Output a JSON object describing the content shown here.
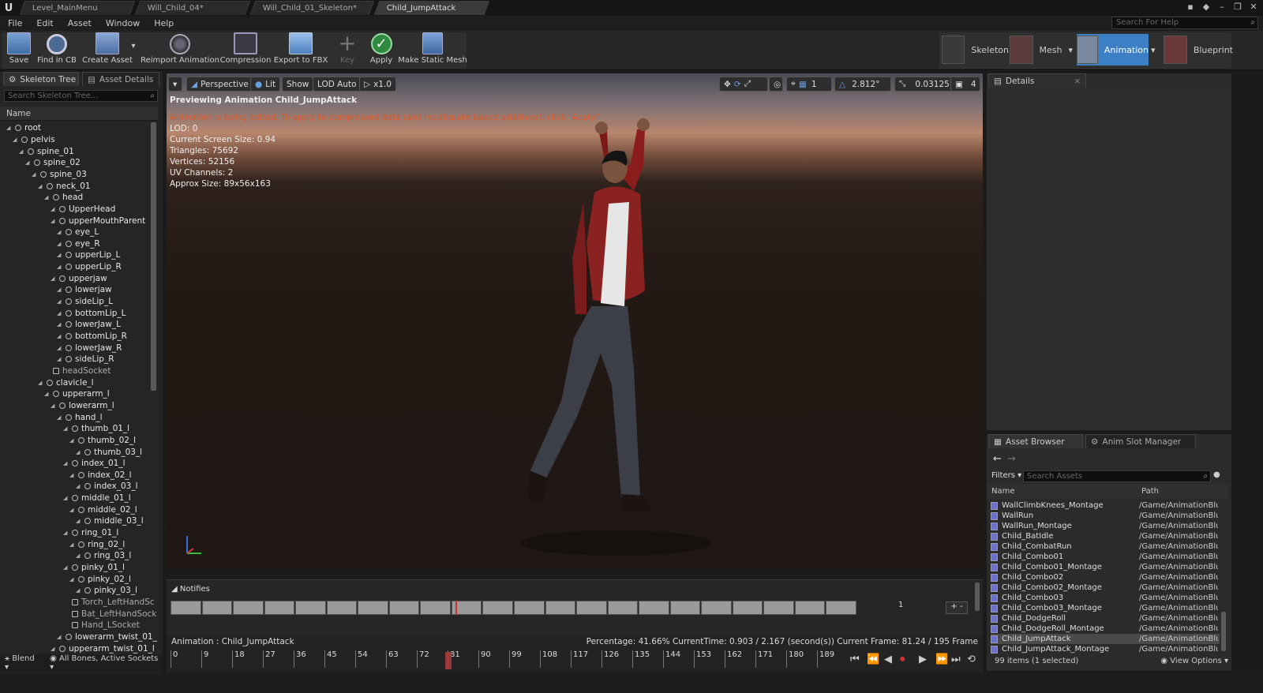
{
  "tabs": [
    {
      "label": "Level_MainMenu",
      "active": false
    },
    {
      "label": "Will_Child_04*",
      "active": false
    },
    {
      "label": "Will_Child_01_Skeleton*",
      "active": false
    },
    {
      "label": "Child_JumpAttack",
      "active": true
    }
  ],
  "menu": [
    "File",
    "Edit",
    "Asset",
    "Window",
    "Help"
  ],
  "help_search_placeholder": "Search For Help",
  "toolbar": {
    "save": "Save",
    "find_in_cb": "Find in CB",
    "create_asset": "Create Asset",
    "reimport": "Reimport Animation",
    "compression": "Compression",
    "export_fbx": "Export to FBX",
    "key": "Key",
    "apply": "Apply",
    "make_static_mesh": "Make Static Mesh"
  },
  "modes": {
    "skeleton": "Skeleton",
    "mesh": "Mesh",
    "animation": "Animation",
    "blueprint": "Blueprint"
  },
  "left_panel": {
    "tab_skeleton_tree": "Skeleton Tree",
    "tab_asset_details": "Asset Details",
    "search_placeholder": "Search Skeleton Tree...",
    "column_name": "Name",
    "bones": [
      {
        "name": "root",
        "depth": 0
      },
      {
        "name": "pelvis",
        "depth": 1
      },
      {
        "name": "spine_01",
        "depth": 2
      },
      {
        "name": "spine_02",
        "depth": 3
      },
      {
        "name": "spine_03",
        "depth": 4
      },
      {
        "name": "neck_01",
        "depth": 5
      },
      {
        "name": "head",
        "depth": 6
      },
      {
        "name": "UpperHead",
        "depth": 7
      },
      {
        "name": "upperMouthParent",
        "depth": 7
      },
      {
        "name": "eye_L",
        "depth": 8
      },
      {
        "name": "eye_R",
        "depth": 8
      },
      {
        "name": "upperLip_L",
        "depth": 8
      },
      {
        "name": "upperLip_R",
        "depth": 8
      },
      {
        "name": "upperjaw",
        "depth": 7
      },
      {
        "name": "lowerjaw",
        "depth": 8
      },
      {
        "name": "sideLip_L",
        "depth": 8
      },
      {
        "name": "bottomLip_L",
        "depth": 8
      },
      {
        "name": "lowerJaw_L",
        "depth": 8
      },
      {
        "name": "bottomLip_R",
        "depth": 8
      },
      {
        "name": "lowerJaw_R",
        "depth": 8
      },
      {
        "name": "sideLip_R",
        "depth": 8
      },
      {
        "name": "headSocket",
        "depth": 6,
        "socket": true
      },
      {
        "name": "clavicle_l",
        "depth": 5
      },
      {
        "name": "upperarm_l",
        "depth": 6
      },
      {
        "name": "lowerarm_l",
        "depth": 7
      },
      {
        "name": "hand_l",
        "depth": 8
      },
      {
        "name": "thumb_01_l",
        "depth": 9
      },
      {
        "name": "thumb_02_l",
        "depth": 10
      },
      {
        "name": "thumb_03_l",
        "depth": 11
      },
      {
        "name": "index_01_l",
        "depth": 9
      },
      {
        "name": "index_02_l",
        "depth": 10
      },
      {
        "name": "index_03_l",
        "depth": 11
      },
      {
        "name": "middle_01_l",
        "depth": 9
      },
      {
        "name": "middle_02_l",
        "depth": 10
      },
      {
        "name": "middle_03_l",
        "depth": 11
      },
      {
        "name": "ring_01_l",
        "depth": 9
      },
      {
        "name": "ring_02_l",
        "depth": 10
      },
      {
        "name": "ring_03_l",
        "depth": 11
      },
      {
        "name": "pinky_01_l",
        "depth": 9
      },
      {
        "name": "pinky_02_l",
        "depth": 10
      },
      {
        "name": "pinky_03_l",
        "depth": 11
      },
      {
        "name": "Torch_LeftHandSc",
        "depth": 9,
        "socket": true
      },
      {
        "name": "Bat_LeftHandSock",
        "depth": 9,
        "socket": true
      },
      {
        "name": "Hand_LSocket",
        "depth": 9,
        "socket": true
      },
      {
        "name": "lowerarm_twist_01_",
        "depth": 8
      },
      {
        "name": "upperarm_twist_01_l",
        "depth": 7
      }
    ],
    "blend_label": "Blend",
    "bones_filter": "All Bones, Active Sockets"
  },
  "viewport": {
    "perspective": "Perspective",
    "lit": "Lit",
    "show": "Show",
    "lod": "LOD Auto",
    "speed": "x1.0",
    "grid_size": "1",
    "angle": "2.812°",
    "scale": "0.03125",
    "camera_speed": "4",
    "preview_title": "Previewing Animation Child_JumpAttack",
    "warning": "Animation is being edited. To apply to compressed data (and recalculate baked additives), click \"Apply\"",
    "stats": [
      "LOD: 0",
      "Current Screen Size: 0.94",
      "Triangles: 75692",
      "Vertices: 52156",
      "UV Channels: 2",
      "Approx Size: 89x56x163"
    ]
  },
  "notifies": {
    "header": "Notifies",
    "track_number": "1"
  },
  "timeline": {
    "animation_label": "Animation :  Child_JumpAttack",
    "status": "Percentage:  41.66% CurrentTime:  0.903 / 2.167 (second(s)) Current Frame:  81.24 / 195 Frame",
    "ticks": [
      "0",
      "9",
      "18",
      "27",
      "36",
      "45",
      "54",
      "63",
      "72",
      "81",
      "90",
      "99",
      "108",
      "117",
      "126",
      "135",
      "144",
      "153",
      "162",
      "171",
      "180",
      "189"
    ],
    "playhead_frame": 81
  },
  "details": {
    "tab": "Details"
  },
  "asset_browser": {
    "tab_asset_browser": "Asset Browser",
    "tab_anim_slot": "Anim Slot Manager",
    "filters": "Filters",
    "search_placeholder": "Search Assets",
    "col_name": "Name",
    "col_path": "Path",
    "items": [
      {
        "name": "WallClimbKnees_Montage",
        "path": "/Game/AnimationBlue"
      },
      {
        "name": "WallRun",
        "path": "/Game/AnimationBlue"
      },
      {
        "name": "WallRun_Montage",
        "path": "/Game/AnimationBlue"
      },
      {
        "name": "Child_BatIdle",
        "path": "/Game/AnimationBlue"
      },
      {
        "name": "Child_CombatRun",
        "path": "/Game/AnimationBlue"
      },
      {
        "name": "Child_Combo01",
        "path": "/Game/AnimationBlue"
      },
      {
        "name": "Child_Combo01_Montage",
        "path": "/Game/AnimationBlue"
      },
      {
        "name": "Child_Combo02",
        "path": "/Game/AnimationBlue"
      },
      {
        "name": "Child_Combo02_Montage",
        "path": "/Game/AnimationBlue"
      },
      {
        "name": "Child_Combo03",
        "path": "/Game/AnimationBlue"
      },
      {
        "name": "Child_Combo03_Montage",
        "path": "/Game/AnimationBlue"
      },
      {
        "name": "Child_DodgeRoll",
        "path": "/Game/AnimationBlue"
      },
      {
        "name": "Child_DodgeRoll_Montage",
        "path": "/Game/AnimationBlue"
      },
      {
        "name": "Child_JumpAttack",
        "path": "/Game/AnimationBlue",
        "selected": true
      },
      {
        "name": "Child_JumpAttack_Montage",
        "path": "/Game/AnimationBlue"
      }
    ],
    "count": "99 items (1 selected)",
    "view_options": "View Options"
  }
}
